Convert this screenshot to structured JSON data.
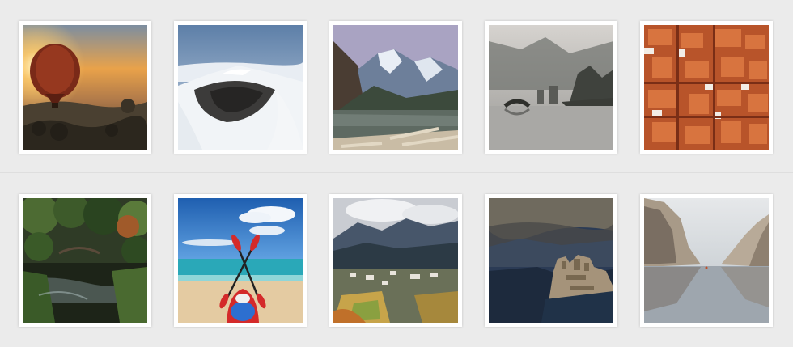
{
  "gallery": {
    "background": "#ebebeb",
    "frame_color": "#ffffff",
    "rows": [
      {
        "photos": [
          {
            "subject": "hot-air-balloon-sunrise"
          },
          {
            "subject": "snowy-volcano-crater"
          },
          {
            "subject": "mountain-lake-logs"
          },
          {
            "subject": "misty-lake-bridge"
          },
          {
            "subject": "orange-rooftops-city"
          }
        ]
      },
      {
        "photos": [
          {
            "subject": "japanese-garden-pond"
          },
          {
            "subject": "kayak-beach-paddles"
          },
          {
            "subject": "mountain-village-valley"
          },
          {
            "subject": "hilltop-castle-town"
          },
          {
            "subject": "canyon-river-cliffs"
          }
        ]
      }
    ]
  }
}
